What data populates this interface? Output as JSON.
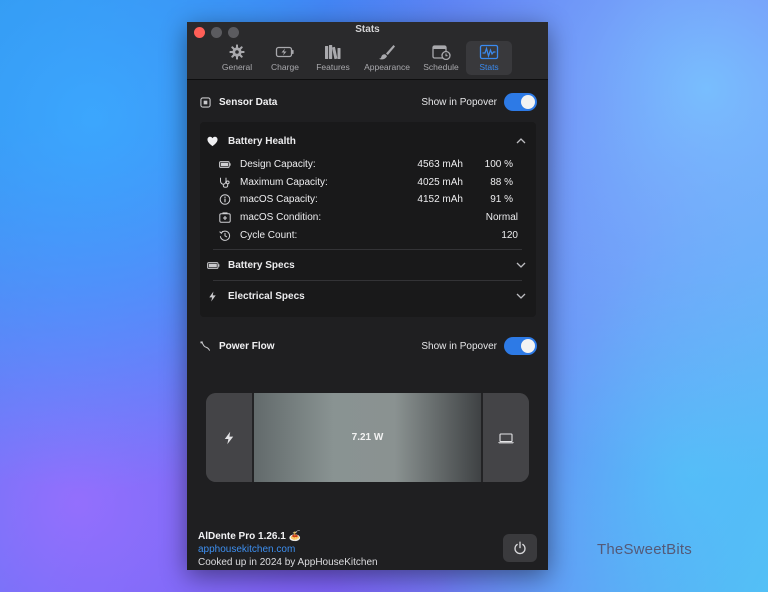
{
  "window": {
    "title": "Stats"
  },
  "toolbar": {
    "items": [
      {
        "label": "General",
        "icon": "gear-icon",
        "active": false
      },
      {
        "label": "Charge",
        "icon": "battery-charging-icon",
        "active": false
      },
      {
        "label": "Features",
        "icon": "books-icon",
        "active": false
      },
      {
        "label": "Appearance",
        "icon": "paintbrush-icon",
        "active": false
      },
      {
        "label": "Schedule",
        "icon": "calendar-clock-icon",
        "active": false
      },
      {
        "label": "Stats",
        "icon": "waveform-icon",
        "active": true
      }
    ]
  },
  "sensor_data": {
    "title": "Sensor Data",
    "popover_label": "Show in Popover",
    "popover_enabled": true,
    "battery_health": {
      "title": "Battery Health",
      "rows": [
        {
          "label": "Design Capacity:",
          "value": "4563 mAh",
          "pct": "100 %",
          "icon": "battery-icon"
        },
        {
          "label": "Maximum Capacity:",
          "value": "4025 mAh",
          "pct": "88 %",
          "icon": "stethoscope-icon"
        },
        {
          "label": "macOS Capacity:",
          "value": "4152 mAh",
          "pct": "91 %",
          "icon": "info-icon"
        },
        {
          "label": "macOS Condition:",
          "value": "Normal",
          "icon": "battery-plus-icon"
        },
        {
          "label": "Cycle Count:",
          "value": "120",
          "icon": "history-icon"
        }
      ]
    },
    "battery_specs": {
      "title": "Battery Specs"
    },
    "electrical_specs": {
      "title": "Electrical Specs"
    }
  },
  "power_flow": {
    "title": "Power Flow",
    "popover_label": "Show in Popover",
    "popover_enabled": true,
    "value": "7.21 W"
  },
  "footer": {
    "app_name": "AlDente Pro 1.26.1 🍝",
    "link": "apphousekitchen.com",
    "credits": "Cooked up in 2024 by AppHouseKitchen"
  },
  "watermark": "TheSweetBits",
  "colors": {
    "accent": "#2d7ae6",
    "link": "#3d8ff0",
    "window_bg": "#1f1f21"
  }
}
